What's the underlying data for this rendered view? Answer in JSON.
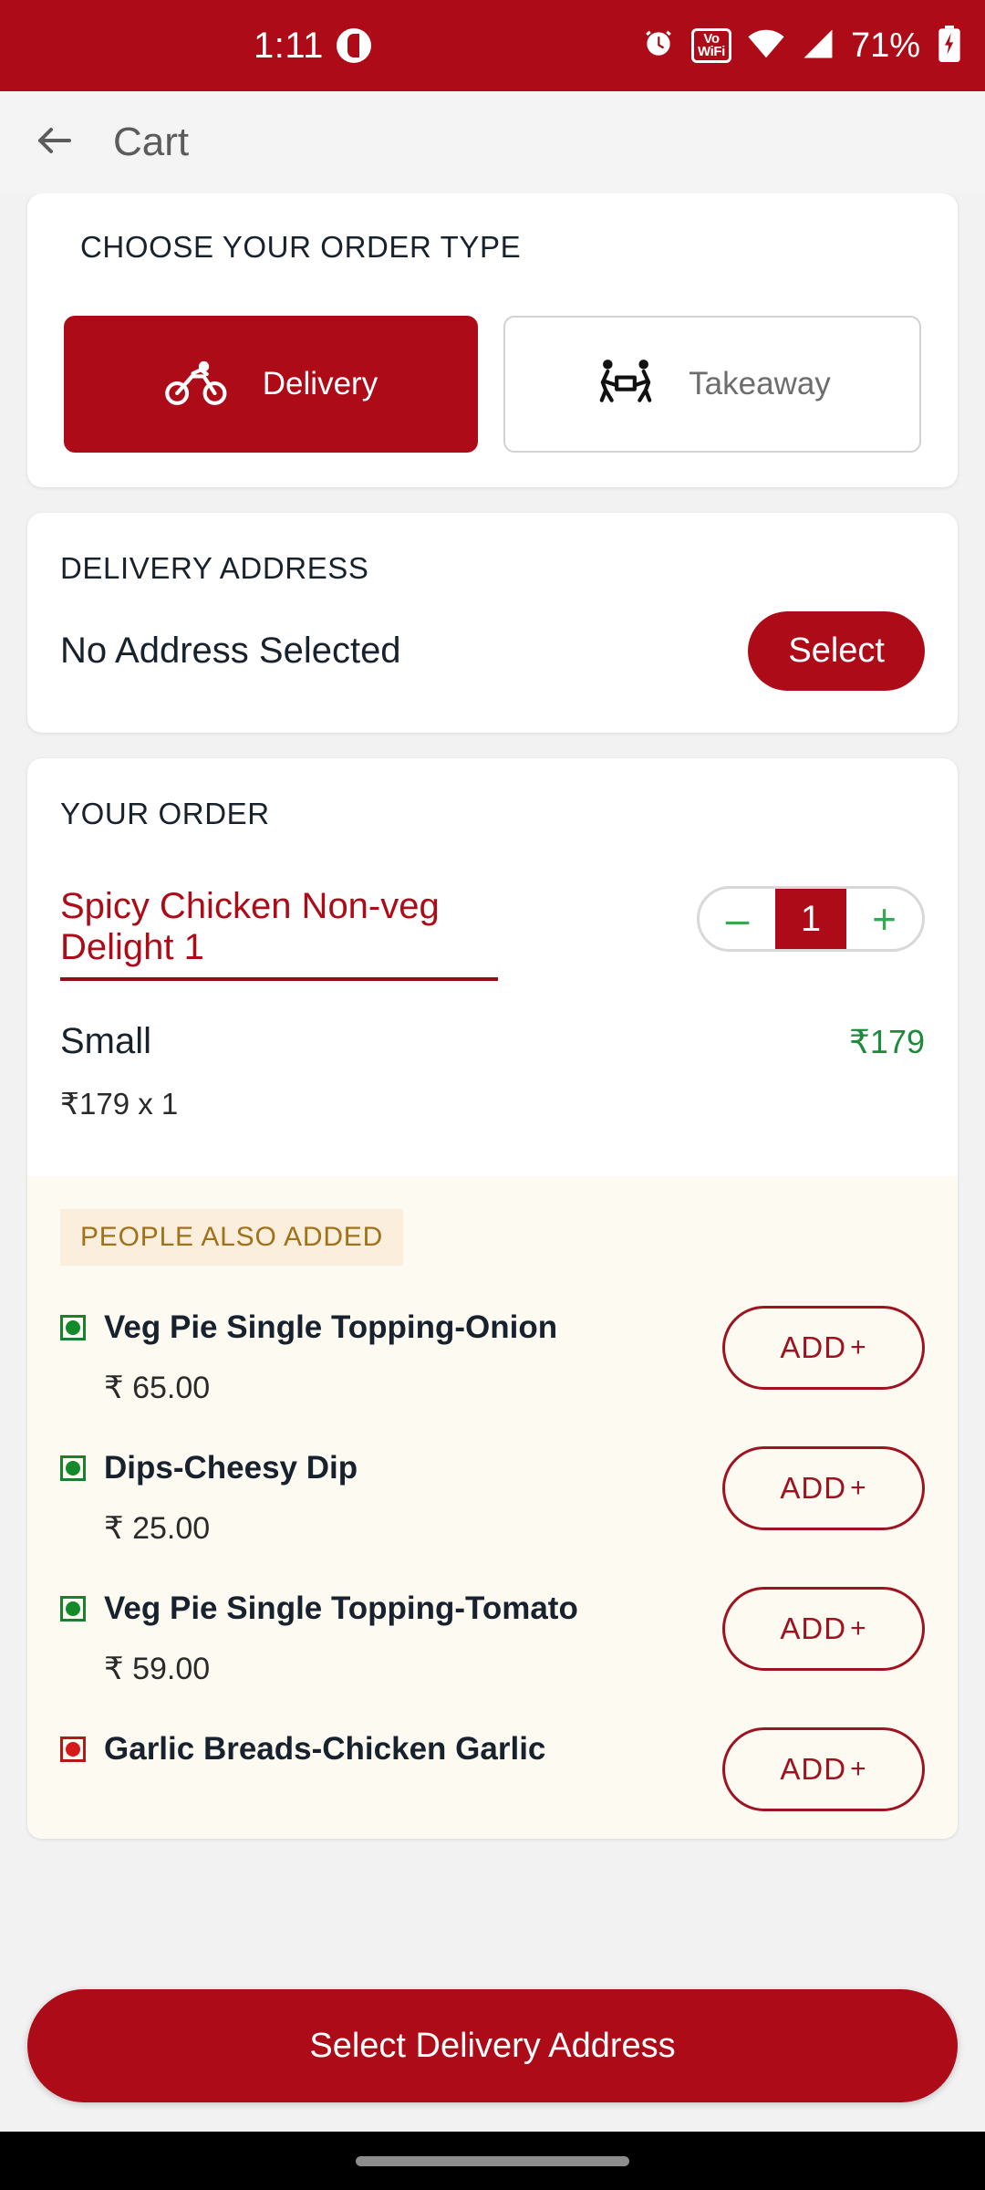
{
  "status_bar": {
    "time": "1:11",
    "app_icon": "app-notification-icon",
    "alarm_icon": "alarm-clock-icon",
    "vowifi_line1": "Vo",
    "vowifi_line2": "WiFi",
    "wifi_icon": "wifi-icon",
    "signal_icon": "cellular-signal-icon",
    "battery_percent": "71%",
    "battery_icon": "battery-charging-icon",
    "background_color": "#AE0B18"
  },
  "app_bar": {
    "back_icon": "back-arrow-icon",
    "title": "Cart"
  },
  "order_type": {
    "title": "CHOOSE YOUR ORDER TYPE",
    "options": [
      {
        "label": "Delivery",
        "icon": "cyclist-delivery-icon",
        "selected": true
      },
      {
        "label": "Takeaway",
        "icon": "two-people-carrying-box-icon",
        "selected": false
      }
    ],
    "accent_color": "#AE0B18"
  },
  "delivery_address": {
    "title": "DELIVERY ADDRESS",
    "value": "No Address Selected",
    "select_label": "Select"
  },
  "your_order": {
    "title": "YOUR ORDER",
    "item": {
      "name": "Spicy Chicken Non-veg Delight 1",
      "size": "Small",
      "price": "₹179",
      "unit_price": "₹179 x 1",
      "quantity": "1",
      "decrement": "–",
      "increment": "+"
    }
  },
  "people_also_added": {
    "badge": "PEOPLE ALSO ADDED",
    "add_label": "ADD",
    "add_plus": "+",
    "items": [
      {
        "name": "Veg Pie Single Topping-Onion",
        "price": "₹ 65.00",
        "diet": "veg"
      },
      {
        "name": "Dips-Cheesy Dip",
        "price": "₹ 25.00",
        "diet": "veg"
      },
      {
        "name": "Veg Pie Single Topping-Tomato",
        "price": "₹ 59.00",
        "diet": "veg"
      },
      {
        "name": "Garlic Breads-Chicken Garlic",
        "price": "",
        "diet": "nonveg"
      }
    ]
  },
  "bottom_cta": {
    "label": "Select Delivery Address"
  },
  "nav_bar": {
    "home_pill": "home-gesture-pill"
  }
}
